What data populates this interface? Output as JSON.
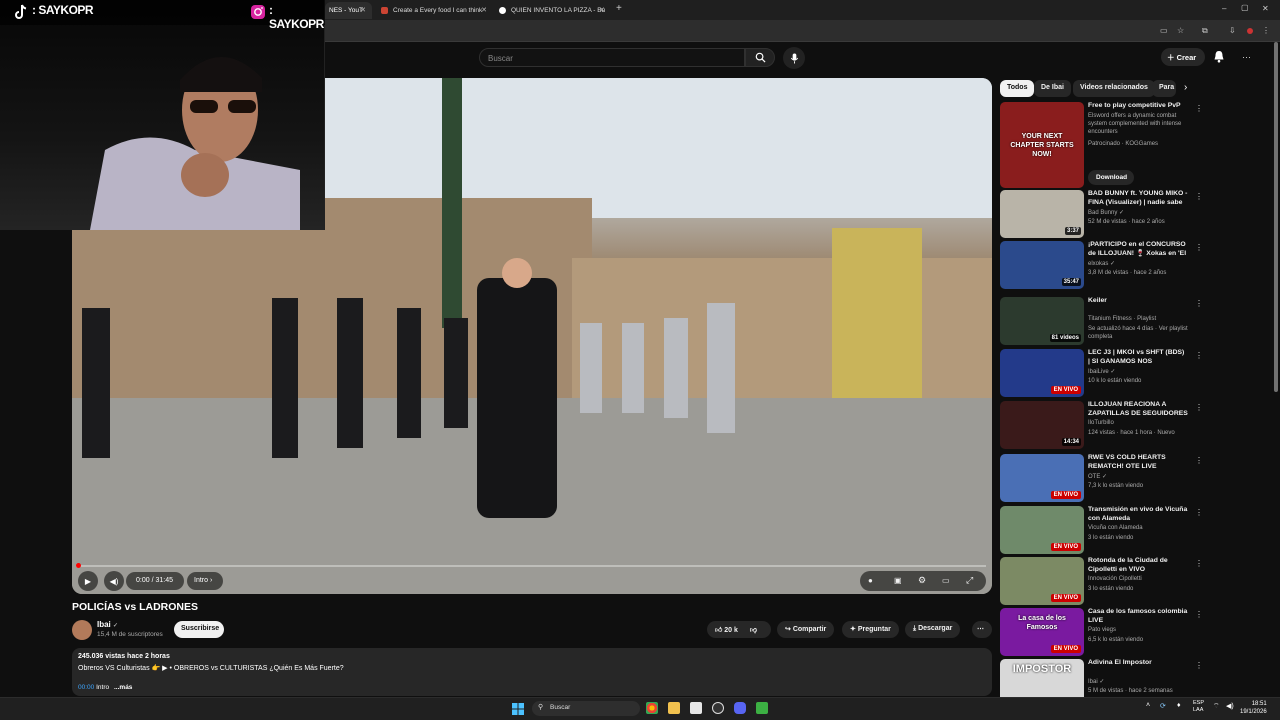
{
  "browser": {
    "tabs": [
      {
        "label": "NES - YouT",
        "active": true
      },
      {
        "label": "Create a Every food I can think",
        "active": false
      },
      {
        "label": "QUIEN INVENTO LA PIZZA - Bu",
        "active": false
      }
    ],
    "new_tab": "+",
    "window_controls": [
      "–",
      "▢",
      "✕"
    ]
  },
  "overlay": {
    "tiktok_handle": ": SAYKOPR",
    "instagram_handle": ": SAYKOPR"
  },
  "header": {
    "search_placeholder": "Buscar",
    "create_label": "Crear",
    "menu_dots": "⋯"
  },
  "player": {
    "time": "0:00 / 31:45",
    "chapter": "Intro",
    "progress_fraction": 0.0
  },
  "video": {
    "title": "POLICÍAS vs LADRONES",
    "channel": "Ibai",
    "verified_mark": "✓",
    "subscribers": "15,4 M de suscriptores",
    "subscribe_label": "Suscribirse",
    "likes": "20 k",
    "share_label": "Compartir",
    "ask_label": "Preguntar",
    "download_label": "Descargar",
    "more_label": "⋯",
    "views_line": "245.036 vistas  hace 2 horas",
    "desc_line": "Obreros VS Culturistas 👉 ▶ • OBREROS vs CULTURISTAS ¿Quién Es Más Fuerte?",
    "desc_timestamp": "00:00",
    "desc_intro": "Intro",
    "desc_more": "...más"
  },
  "chips": [
    "Todos",
    "De Ibai",
    "Videos relacionados",
    "Para"
  ],
  "recommendations": [
    {
      "title": "Free to play competitive PvP",
      "channel": "Elsword offers a dynamic combat system complemented with intense encounters",
      "meta": "Patrocinado · KOGGames",
      "badge": "",
      "cta": "Download",
      "thumb": "#8a1d1d"
    },
    {
      "title": "BAD BUNNY ft. YOUNG MIKO - FINA (Visualizer) | nadie sabe l...",
      "channel": "Bad Bunny ✓",
      "meta": "52 M de vistas · hace 2 años",
      "badge": "3:37",
      "thumb": "#b9b4a8"
    },
    {
      "title": "¡PARTICIPO en el CONCURSO de ILLOJUAN! 🍷 Xokas en 'El ...",
      "channel": "elxokas ✓",
      "meta": "3,8 M de vistas · hace 2 años",
      "badge": "35:47",
      "thumb": "#2b4a8c"
    },
    {
      "title": "Keiler",
      "channel": "Titanium Fitness · Playlist",
      "meta": "Se actualizó hace 4 días · Ver playlist completa",
      "badge": "81 videos",
      "thumb": "#2c3a2e"
    },
    {
      "title": "LEC J3 | MKOI vs SHFT (BDS) | SI GANAMOS NOS PONEMOS ...",
      "channel": "IbaiLive ✓",
      "meta": "10 k lo están viendo",
      "badge": "EN VIVO",
      "thumb": "#233a8a"
    },
    {
      "title": "ILLOJUAN REACIONA A ZAPATILLAS DE SEGUIDORES",
      "channel": "IloTurbillo",
      "meta": "124 vistas · hace 1 hora · Nuevo",
      "badge": "14:34",
      "thumb": "#3a1a1a"
    },
    {
      "title": "RWE VS COLD HEARTS REMATCH! OTE LIVE",
      "channel": "OTE ✓",
      "meta": "7,3 k lo están viendo",
      "badge": "EN VIVO",
      "thumb": "#4a6fb5"
    },
    {
      "title": "Transmisión en vivo de Vicuña con Alameda",
      "channel": "Vicuña con Alameda",
      "meta": "3 lo están viendo",
      "badge": "EN VIVO",
      "thumb": "#6f8a6a"
    },
    {
      "title": "Rotonda de la Ciudad de Cipolletti en VIVO",
      "channel": "Innovación Cipolletti",
      "meta": "3 lo están viendo",
      "badge": "EN VIVO",
      "thumb": "#7c8a64"
    },
    {
      "title": "Casa de los famosos colombia LIVE",
      "channel": "Pato viegs",
      "meta": "6,5 k lo están viendo",
      "badge": "EN VIVO",
      "thumb": "#7a1aa0"
    },
    {
      "title": "Adivina El Impostor",
      "channel": "Ibai ✓",
      "meta": "5 M de vistas · hace 2 semanas",
      "badge": "",
      "thumb": "#d8d8d8"
    }
  ],
  "thumb_overlays": {
    "ad": "YOUR NEXT CHAPTER STARTS NOW!",
    "famosos": "La casa de los Famosos",
    "impostor": "IMPOSTOR"
  },
  "taskbar": {
    "search": "Buscar",
    "lang": "ESP\nLAA",
    "time": "18:51",
    "date": "19/1/2026"
  },
  "colors": {
    "accent_red": "#ff0000",
    "live_red": "#cc0000",
    "link_blue": "#3ea6ff"
  }
}
